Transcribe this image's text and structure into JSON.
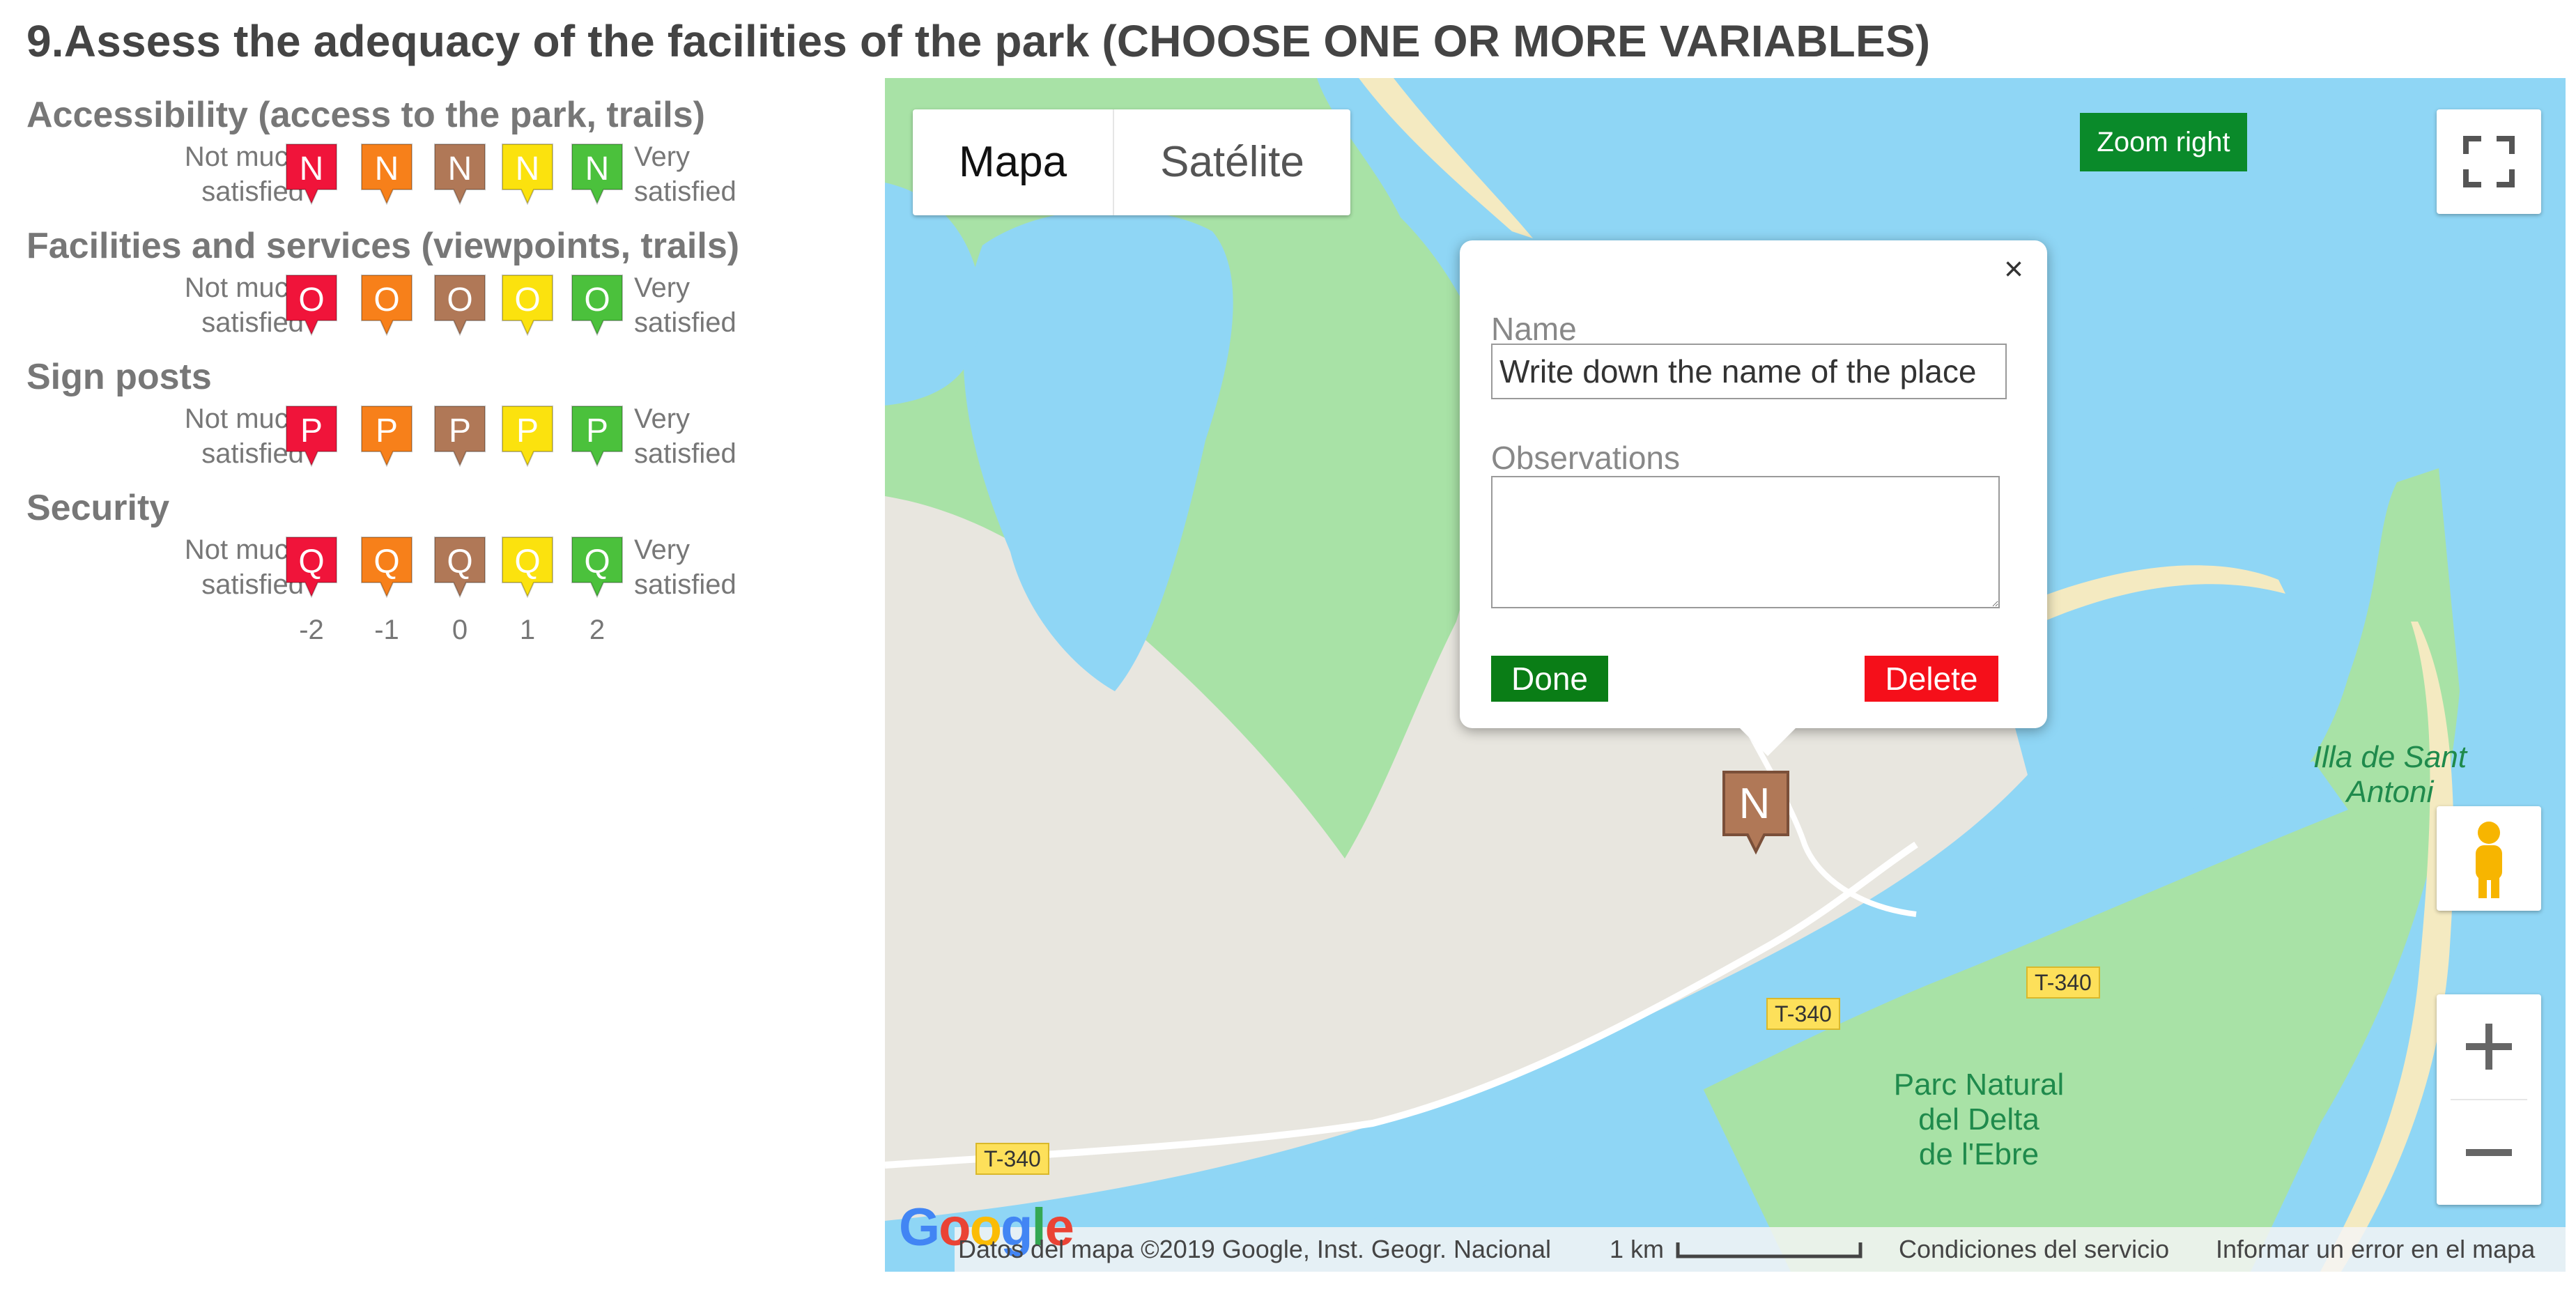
{
  "question": {
    "title": "9.Assess the adequacy of the facilities of the park (CHOOSE ONE OR MORE VARIABLES)"
  },
  "scale_labels": {
    "low": "Not much satisfied",
    "high": "Very satisfied"
  },
  "scale_low_lines": [
    "Not much",
    "satisfied"
  ],
  "scale_high_lines": [
    "Very",
    "satisfied"
  ],
  "pin_colors": [
    "#f0143a",
    "#f7801a",
    "#b07857",
    "#fbe20e",
    "#4bc13c"
  ],
  "variables": [
    {
      "title": "Accessibility (access to the park, trails)",
      "letter": "N"
    },
    {
      "title": "Facilities and services (viewpoints, trails)",
      "letter": "O"
    },
    {
      "title": "Sign posts",
      "letter": "P"
    },
    {
      "title": "Security",
      "letter": "Q"
    }
  ],
  "scale_values": [
    "-2",
    "-1",
    "0",
    "1",
    "2"
  ],
  "map": {
    "type_tabs": [
      "Mapa",
      "Satélite"
    ],
    "active_tab": "Mapa",
    "zoom_right_label": "Zoom right",
    "places": {
      "island": "Illa de Sant Antoni",
      "island_lines": [
        "Illa de Sant",
        "Antoni"
      ],
      "park_lines": [
        "Parc Natural",
        "del Delta",
        "de l'Ebre"
      ]
    },
    "roads": [
      "T-340",
      "T-340",
      "T-340"
    ],
    "placed_marker_letter": "N",
    "placed_marker_color": "#b07857",
    "footer": {
      "data": "Datos del mapa ©2019 Google, Inst. Geogr. Nacional",
      "scale": "1 km",
      "terms": "Condiciones del servicio",
      "report": "Informar un error en el mapa"
    },
    "google_logo": "Google"
  },
  "popup": {
    "name_label": "Name",
    "name_placeholder": "Write down the name of the place",
    "obs_label": "Observations",
    "done_label": "Done",
    "delete_label": "Delete",
    "close_glyph": "×"
  }
}
